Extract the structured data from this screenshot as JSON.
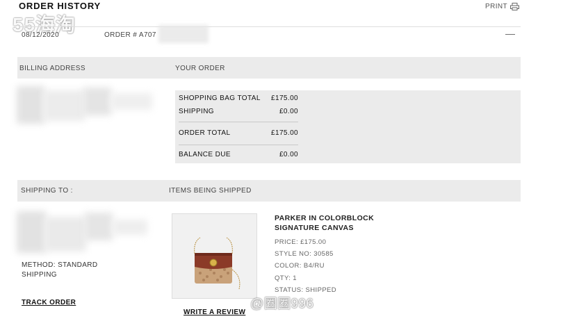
{
  "header": {
    "title": "ORDER HISTORY",
    "print_label": "PRINT",
    "watermark": "55海淘"
  },
  "order": {
    "date": "08/12/2020",
    "number_prefix": "ORDER # A707"
  },
  "billing": {
    "billing_label": "BILLING ADDRESS",
    "your_order_label": "YOUR ORDER"
  },
  "summary": {
    "rows": [
      {
        "label": "SHOPPING BAG TOTAL",
        "value": "£175.00"
      },
      {
        "label": "SHIPPING",
        "value": "£0.00"
      },
      {
        "label": "ORDER TOTAL",
        "value": "£175.00"
      },
      {
        "label": "BALANCE DUE",
        "value": "£0.00"
      }
    ]
  },
  "shipping": {
    "shipping_to_label": "SHIPPING TO :",
    "items_label": "ITEMS BEING SHIPPED",
    "method_line1": "METHOD: STANDARD",
    "method_line2": "SHIPPING",
    "track_order": "TRACK ORDER"
  },
  "product": {
    "name_line1": "PARKER IN COLORBLOCK",
    "name_line2": "SIGNATURE CANVAS",
    "price": "PRICE: £175.00",
    "style": "STYLE NO: 30585",
    "color": "COLOR: B4/RU",
    "qty": "QTY: 1",
    "status": "STATUS: SHIPPED",
    "review_link": "WRITE A REVIEW"
  },
  "weibo_watermark": "@圈圈996",
  "colors": {
    "section_bg": "#ebebeb",
    "bag_brown": "#8b3a28",
    "bag_tan": "#c9a27a"
  }
}
